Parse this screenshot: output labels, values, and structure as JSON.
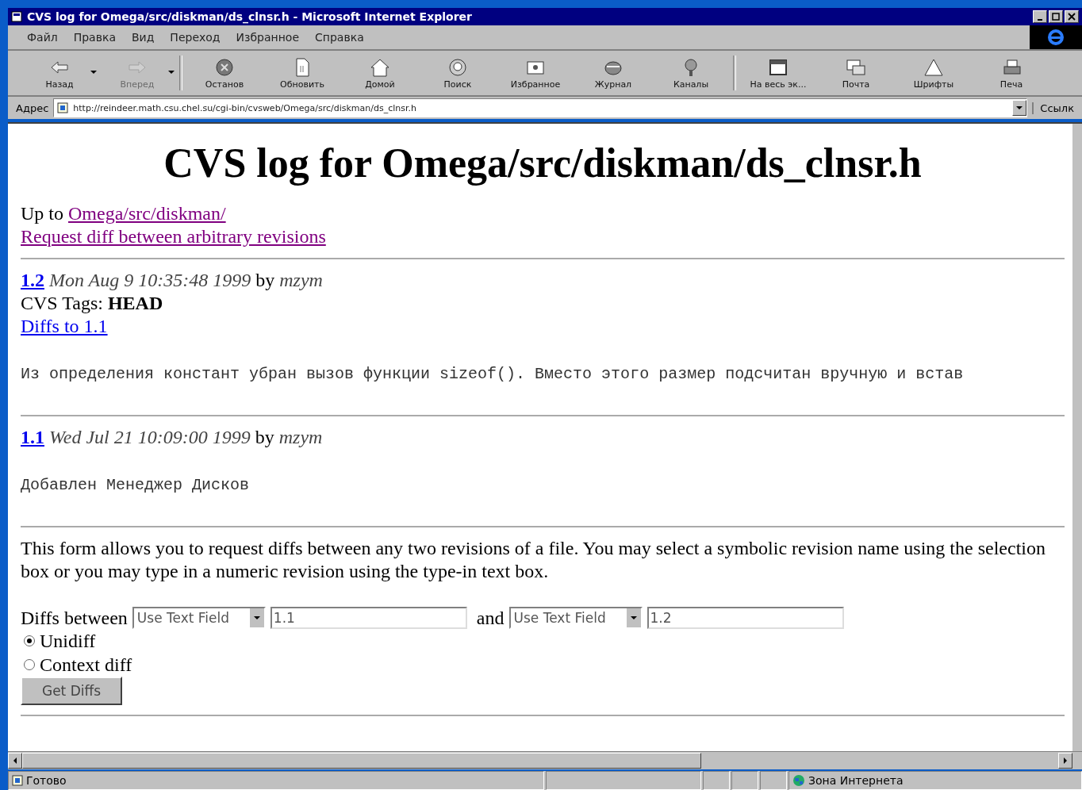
{
  "window": {
    "title": "CVS log for Omega/src/diskman/ds_clnsr.h - Microsoft Internet Explorer"
  },
  "menu": [
    {
      "label": "Файл"
    },
    {
      "label": "Правка"
    },
    {
      "label": "Вид"
    },
    {
      "label": "Переход"
    },
    {
      "label": "Избранное"
    },
    {
      "label": "Справка"
    }
  ],
  "toolbar": [
    {
      "label": "Назад",
      "disabled": false,
      "dropdown": true
    },
    {
      "label": "Вперед",
      "disabled": true,
      "dropdown": true
    },
    {
      "label": "Останов",
      "disabled": false,
      "dropdown": false
    },
    {
      "label": "Обновить",
      "disabled": false,
      "dropdown": false
    },
    {
      "label": "Домой",
      "disabled": false,
      "dropdown": false
    },
    {
      "label": "Поиск",
      "disabled": false,
      "dropdown": false
    },
    {
      "label": "Избранное",
      "disabled": false,
      "dropdown": false
    },
    {
      "label": "Журнал",
      "disabled": false,
      "dropdown": false
    },
    {
      "label": "Каналы",
      "disabled": false,
      "dropdown": false
    },
    {
      "label": "На весь эк...",
      "disabled": false,
      "dropdown": false
    },
    {
      "label": "Почта",
      "disabled": false,
      "dropdown": false
    },
    {
      "label": "Шрифты",
      "disabled": false,
      "dropdown": false
    },
    {
      "label": "Печа",
      "disabled": false,
      "dropdown": false
    }
  ],
  "address_bar": {
    "label": "Адрес",
    "value": "http://reindeer.math.csu.chel.su/cgi-bin/cvsweb/Omega/src/diskman/ds_clnsr.h",
    "links": "Ссылк"
  },
  "page": {
    "heading": "CVS log for Omega/src/diskman/ds_clnsr.h",
    "up_to_label": "Up to",
    "up_to_link": "Omega/src/diskman/",
    "request_link": "Request diff between arbitrary revisions",
    "revisions": [
      {
        "revision": "1.2",
        "date": "Mon Aug 9 10:35:48 1999",
        "by": "by",
        "author": "mzym",
        "tags_label": "CVS Tags:",
        "tags": "HEAD",
        "diff_link": "Diffs to 1.1",
        "message": "Из определения констант убран вызов функции sizeof(). Вместо этого размер подсчитан вручную и встав"
      },
      {
        "revision": "1.1",
        "date": "Wed Jul 21 10:09:00 1999",
        "by": "by",
        "author": "mzym",
        "message": "Добавлен Менеджер Дисков"
      }
    ],
    "form_text": "This form allows you to request diffs between any two revisions of a file. You may select a symbolic revision name using the selection box or you may type in a numeric revision using the type-in text box.",
    "diffs_label": "Diffs between",
    "select_1": "Use Text Field",
    "input_1": "1.1",
    "and_label": "and",
    "select_2": "Use Text Field",
    "input_2": "1.2",
    "options": [
      {
        "label": "Unidiff",
        "selected": true
      },
      {
        "label": "Context diff",
        "selected": false
      }
    ],
    "button": "Get Diffs"
  },
  "status_bar": {
    "text": "Готово",
    "zone": "Зона Интернета"
  }
}
